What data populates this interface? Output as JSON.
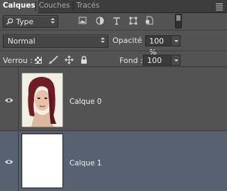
{
  "tabs": [
    {
      "label": "Calques",
      "active": true
    },
    {
      "label": "Couches",
      "active": false
    },
    {
      "label": "Tracés",
      "active": false
    }
  ],
  "filter": {
    "kind_label": "Type",
    "icons": [
      "image-filter-icon",
      "adjustment-filter-icon",
      "text-filter-icon",
      "shape-filter-icon",
      "smart-object-filter-icon",
      "filter-toggle-icon"
    ]
  },
  "blend": {
    "mode": "Normal",
    "opacity_label": "Opacité :",
    "opacity_value": "100 %"
  },
  "lock": {
    "label": "Verrou :",
    "icons": [
      "lock-transparent-icon",
      "lock-paint-icon",
      "lock-move-icon",
      "lock-all-icon"
    ],
    "fill_label": "Fond :",
    "fill_value": "100 %"
  },
  "layers": [
    {
      "name": "Calque 0",
      "visible": true,
      "selected": false,
      "thumb": "portrait"
    },
    {
      "name": "Calque 1",
      "visible": true,
      "selected": true,
      "thumb": "white"
    }
  ],
  "colors": {
    "panel": "#535353",
    "tabbar": "#3c3c3c",
    "selected_layer": "#576171"
  }
}
